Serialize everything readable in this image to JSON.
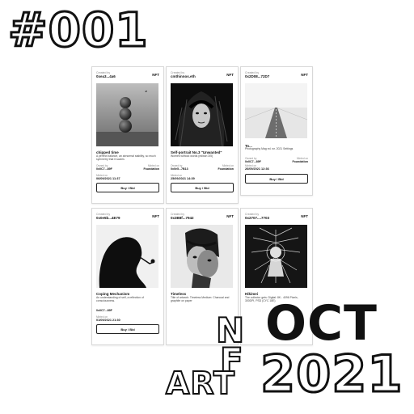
{
  "title_number": "#001",
  "brand": {
    "letter_n": "N",
    "letter_f": "F",
    "word_art": "ART",
    "month": "OCT",
    "year": "2021"
  },
  "cards": [
    {
      "created_by_label": "Created by",
      "creator": "0xea3...4a6",
      "badge": "NFT",
      "name": "chipped time",
      "description": "A perfect balance, an abnormal stability, so much symmetry that it scares",
      "owned_label": "Owned by",
      "minted_on_label": "Minted on",
      "owner": "0x0C7...89F",
      "platform": "Foundation",
      "minted_label": "Minted on",
      "minted_date": "06/09/2021 11:37",
      "buy_label": "Buy / Bid",
      "art": "spheres-icon"
    },
    {
      "created_by_label": "Created by",
      "creator": "cmthinnos.eth",
      "badge": "NFT",
      "name": "Self-portrait No.3 \"Unwanted\"",
      "description": "Worries without words (edition 3/5)",
      "owned_label": "Owned by",
      "minted_on_label": "Minted on",
      "owner": "0x0e5...7B13",
      "platform": "Foundation",
      "minted_label": "Minted on",
      "minted_date": "25/09/2021 14:39",
      "buy_label": "Buy / Bid",
      "art": "portrait-icon"
    },
    {
      "created_by_label": "Created by",
      "creator": "0x2D08...72D7",
      "badge": "NFT",
      "name": "To...",
      "description": "Photography Mag ed. wr. 2021 Settings",
      "owned_label": "Owned by",
      "minted_on_label": "Minted on",
      "owner": "0x0C7...89F",
      "platform": "Foundation",
      "minted_label": "Minted on",
      "minted_date": "26/09/2021 12:36",
      "buy_label": "Buy / Bid",
      "art": "road-icon"
    },
    {
      "created_by_label": "Created by",
      "creator": "0x0e5b...4E79",
      "badge": "NFT",
      "name": "Coping Mechanism",
      "description": "An understanding of self, a reflection of consciousness.",
      "owned_label": "",
      "minted_on_label": "",
      "owner": "0x0C7...89F",
      "platform": "",
      "minted_label": "Minted on",
      "minted_date": "01/09/2021 21:30",
      "buy_label": "Buy / Bid",
      "art": "silhouette-icon"
    },
    {
      "created_by_label": "Created by",
      "creator": "0x3B8f...7942",
      "badge": "NFT",
      "name": "Timeless",
      "description": "Title of artwork: Timeless Medium: Charcoal and graphite on paper",
      "owned_label": "",
      "minted_on_label": "",
      "owner": "",
      "platform": "",
      "minted_label": "",
      "minted_date": "",
      "buy_label": "",
      "art": "split-face-icon"
    },
    {
      "created_by_label": "Created by",
      "creator": "0x2707....7703",
      "badge": "NFT",
      "name": "Hikimei",
      "description": "The collector gets: Digital: 8K - 4096 Pixels, 300DPI, PSD (CYC 18E)",
      "owned_label": "",
      "minted_on_label": "",
      "owner": "",
      "platform": "",
      "minted_label": "",
      "minted_date": "",
      "buy_label": "",
      "art": "ornate-figure-icon"
    }
  ]
}
